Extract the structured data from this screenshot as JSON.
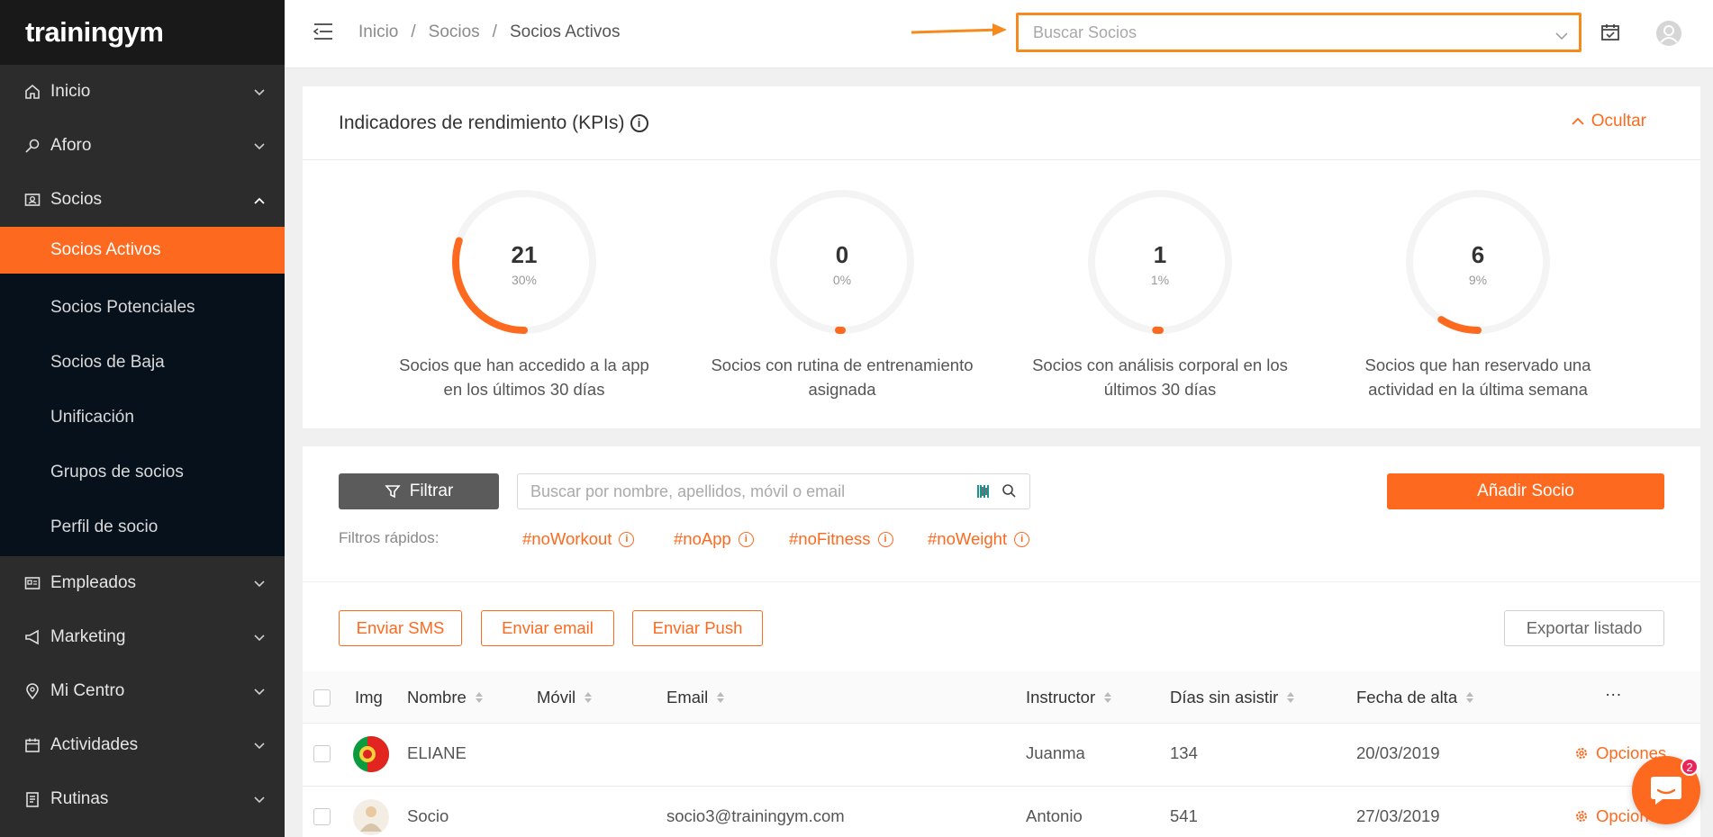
{
  "app": {
    "logo": "trainingym"
  },
  "sidebar": {
    "items": [
      {
        "label": "Inicio",
        "icon": "home-icon"
      },
      {
        "label": "Aforo",
        "icon": "key-icon"
      },
      {
        "label": "Socios",
        "icon": "id-card-icon"
      },
      {
        "label": "Empleados",
        "icon": "badge-icon"
      },
      {
        "label": "Marketing",
        "icon": "megaphone-icon"
      },
      {
        "label": "Mi Centro",
        "icon": "location-pin-icon"
      },
      {
        "label": "Actividades",
        "icon": "calendar-icon"
      },
      {
        "label": "Rutinas",
        "icon": "clipboard-icon"
      }
    ],
    "socios_submenu": [
      "Socios Activos",
      "Socios Potenciales",
      "Socios de Baja",
      "Unificación",
      "Grupos de socios",
      "Perfil de socio"
    ]
  },
  "topbar": {
    "breadcrumb": [
      "Inicio",
      "Socios",
      "Socios Activos"
    ],
    "breadcrumb_sep": "/",
    "search_placeholder": "Buscar Socios"
  },
  "kpis": {
    "title": "Indicadores de rendimiento (KPIs)",
    "hide_label": "Ocultar",
    "items": [
      {
        "value": "21",
        "percent": "30%",
        "fraction": 0.3,
        "label": "Socios que han accedido a la app en los últimos 30 días"
      },
      {
        "value": "0",
        "percent": "0%",
        "fraction": 0.0,
        "label": "Socios con rutina de entrenamiento asignada"
      },
      {
        "value": "1",
        "percent": "1%",
        "fraction": 0.01,
        "label": "Socios con análisis corporal en los últimos 30 días"
      },
      {
        "value": "6",
        "percent": "9%",
        "fraction": 0.09,
        "label": "Socios que han reservado una actividad en la última semana"
      }
    ]
  },
  "list": {
    "filter_label": "Filtrar",
    "search_placeholder": "Buscar por nombre, apellidos, móvil o email",
    "add_label": "Añadir Socio",
    "quick_filters_label": "Filtros rápidos:",
    "quick_filters": [
      "#noWorkout",
      "#noApp",
      "#noFitness",
      "#noWeight"
    ],
    "actions": {
      "sms": "Enviar SMS",
      "email": "Enviar email",
      "push": "Enviar Push",
      "export": "Exportar listado"
    },
    "columns": {
      "img": "Img",
      "nombre": "Nombre",
      "movil": "Móvil",
      "email": "Email",
      "instructor": "Instructor",
      "dias": "Días sin asistir",
      "fecha": "Fecha de alta",
      "more": "···"
    },
    "rows": [
      {
        "nombre": "ELIANE",
        "movil": "",
        "email": "",
        "instructor": "Juanma",
        "dias": "134",
        "fecha": "20/03/2019",
        "options": "Opciones"
      },
      {
        "nombre": "Socio",
        "movil": "",
        "email": "socio3@trainingym.com",
        "instructor": "Antonio",
        "dias": "541",
        "fecha": "27/03/2019",
        "options": "Opciones"
      }
    ]
  },
  "chat": {
    "badge": "2"
  },
  "colors": {
    "accent": "#fd6a1f",
    "sidebar": "#2c2c2c",
    "highlight": "#f58a1f"
  }
}
